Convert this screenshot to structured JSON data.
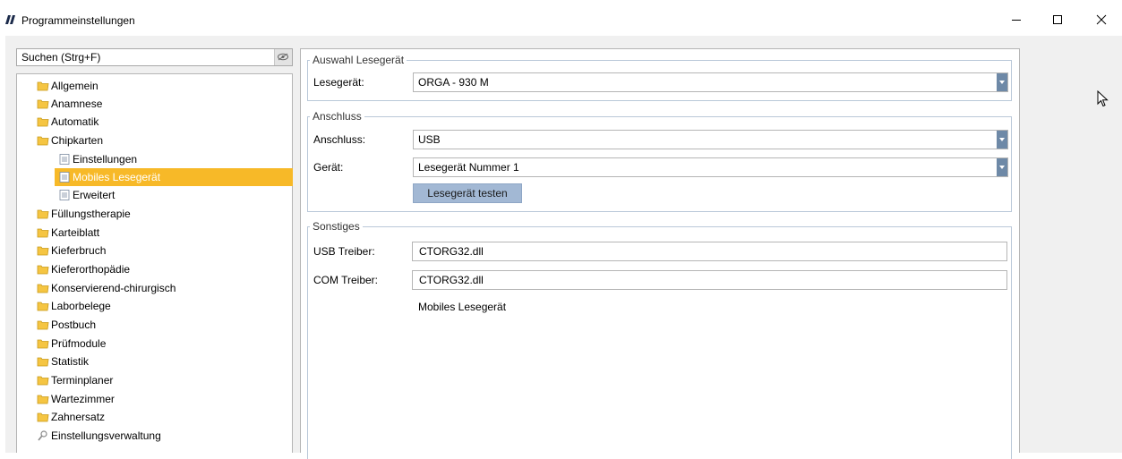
{
  "window": {
    "title": "Programmeinstellungen",
    "minimize_icon": "minimize-icon",
    "maximize_icon": "maximize-icon",
    "close_icon": "close-icon"
  },
  "search": {
    "placeholder": "Suchen (Strg+F)",
    "clear_icon": "eye-icon"
  },
  "tree": {
    "items": [
      {
        "label": "Allgemein",
        "icon": "folder-icon",
        "level": 0
      },
      {
        "label": "Anamnese",
        "icon": "folder-icon",
        "level": 0
      },
      {
        "label": "Automatik",
        "icon": "folder-icon",
        "level": 0
      },
      {
        "label": "Chipkarten",
        "icon": "folder-icon",
        "level": 0
      },
      {
        "label": "Einstellungen",
        "icon": "document-icon",
        "level": 1
      },
      {
        "label": "Mobiles Lesegerät",
        "icon": "document-icon",
        "level": 1,
        "selected": true
      },
      {
        "label": "Erweitert",
        "icon": "document-icon",
        "level": 1
      },
      {
        "label": "Füllungstherapie",
        "icon": "folder-icon",
        "level": 0
      },
      {
        "label": "Karteiblatt",
        "icon": "folder-icon",
        "level": 0
      },
      {
        "label": "Kieferbruch",
        "icon": "folder-icon",
        "level": 0
      },
      {
        "label": "Kieferorthopädie",
        "icon": "folder-icon",
        "level": 0
      },
      {
        "label": "Konservierend-chirurgisch",
        "icon": "folder-icon",
        "level": 0
      },
      {
        "label": "Laborbelege",
        "icon": "folder-icon",
        "level": 0
      },
      {
        "label": "Postbuch",
        "icon": "folder-icon",
        "level": 0
      },
      {
        "label": "Prüfmodule",
        "icon": "folder-icon",
        "level": 0
      },
      {
        "label": "Statistik",
        "icon": "folder-icon",
        "level": 0
      },
      {
        "label": "Terminplaner",
        "icon": "folder-icon",
        "level": 0
      },
      {
        "label": "Wartezimmer",
        "icon": "folder-icon",
        "level": 0
      },
      {
        "label": "Zahnersatz",
        "icon": "folder-icon",
        "level": 0
      },
      {
        "label": "Einstellungsverwaltung",
        "icon": "settings-icon",
        "level": 0
      }
    ]
  },
  "auswahl": {
    "legend": "Auswahl Lesegerät",
    "lesegeraet_label": "Lesegerät:",
    "lesegeraet_value": "ORGA - 930 M"
  },
  "anschluss": {
    "legend": "Anschluss",
    "anschluss_label": "Anschluss:",
    "anschluss_value": "USB",
    "geraet_label": "Gerät:",
    "geraet_value": "Lesegerät Nummer 1",
    "test_button": "Lesegerät testen"
  },
  "sonstiges": {
    "legend": "Sonstiges",
    "usb_label": "USB Treiber:",
    "usb_value": "CTORG32.dll",
    "com_label": "COM Treiber:",
    "com_value": "CTORG32.dll",
    "info_text": "Mobiles Lesegerät"
  },
  "colors": {
    "selection": "#f7b928",
    "accent": "#6e89a7",
    "button": "#a2b8d4",
    "folder": "#f5c542"
  }
}
